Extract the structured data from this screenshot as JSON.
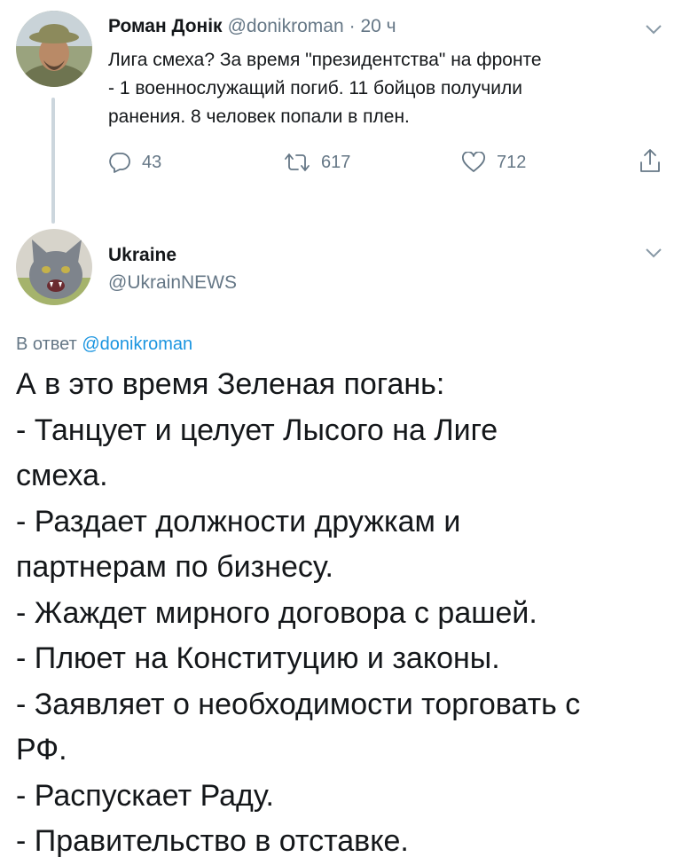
{
  "tweet1": {
    "display_name": "Роман Донік",
    "handle": "@donikroman",
    "time": "· 20 ч",
    "text_lines": [
      "Лига смеха? За время \"президентства\" на фронте",
      "- 1 военнослужащий погиб. 11 бойцов получили",
      "ранения. 8 человек попали в плен."
    ],
    "replies": "43",
    "retweets": "617",
    "likes": "712",
    "icons": [
      "chevron-down-icon",
      "reply-icon",
      "retweet-icon",
      "like-icon",
      "share-icon"
    ]
  },
  "tweet2": {
    "display_name": "Ukraine",
    "handle": "@UkrainNEWS",
    "replying_prefix": "В ответ",
    "replying_to": "@donikroman",
    "text_lines": [
      "А в это время Зеленая погань:",
      "- Танцует и целует Лысого на Лиге",
      "смеха.",
      "- Раздает должности дружкам и",
      "партнерам по бизнесу.",
      "- Жаждет мирного договора с рашей.",
      "- Плюет на Конституцию и законы.",
      "- Заявляет о необходимости торговать с",
      "РФ.",
      "- Распускает Раду.",
      "- Правительство в отставке."
    ]
  },
  "colors": {
    "text": "#14171a",
    "secondary": "#657786",
    "link": "#1b95e0",
    "thread_line": "#ccd6dd"
  }
}
